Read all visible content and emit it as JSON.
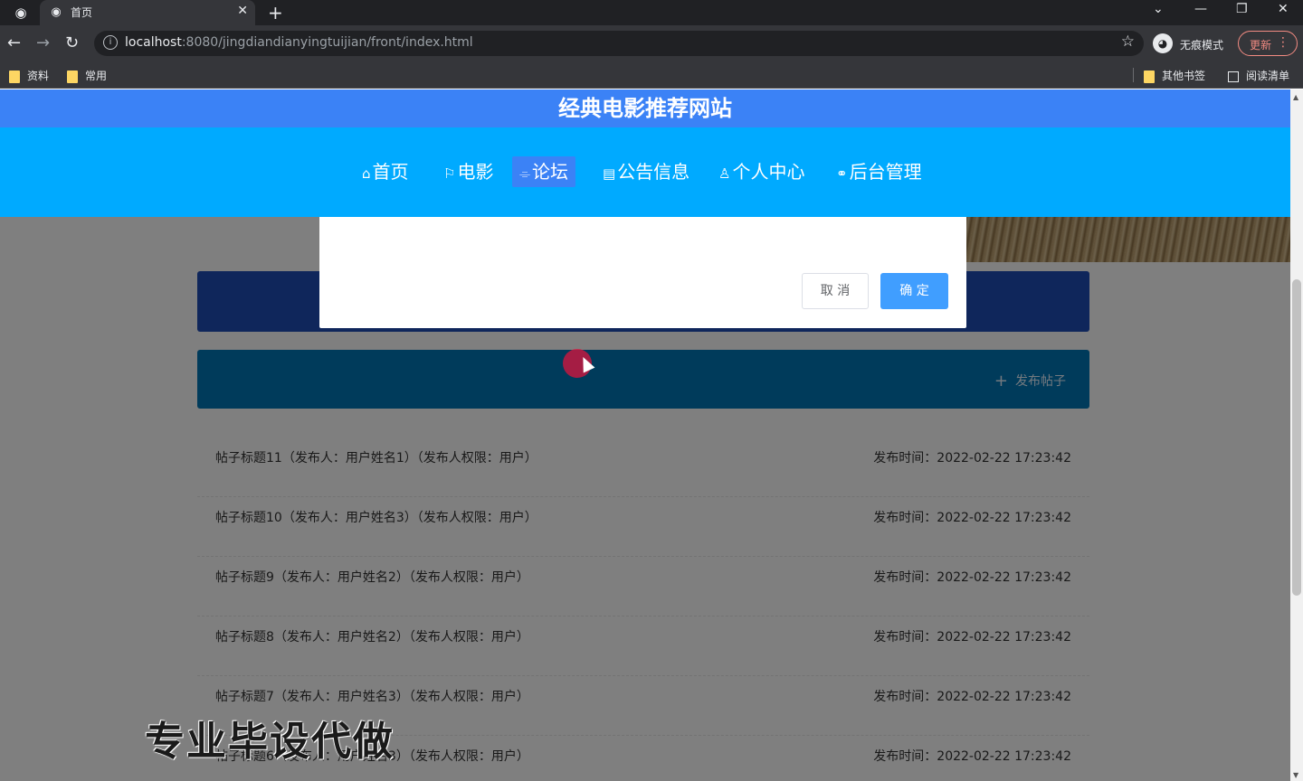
{
  "browser": {
    "tab_title": "首页",
    "new_tab": "+",
    "url_host": "localhost",
    "url_path": ":8080/jingdiandianyingtuijian/front/index.html",
    "incognito_label": "无痕模式",
    "update_label": "更新",
    "bookmarks": [
      "资料",
      "常用"
    ],
    "other_bookmarks": "其他书签",
    "reading_list": "阅读清单"
  },
  "site": {
    "title": "经典电影推荐网站",
    "nav": [
      {
        "icon": "⌂",
        "label": "首页"
      },
      {
        "icon": "⚐",
        "label": "电影"
      },
      {
        "icon": "⌯",
        "label": "论坛"
      },
      {
        "icon": "▤",
        "label": "公告信息"
      },
      {
        "icon": "♙",
        "label": "个人中心"
      },
      {
        "icon": "⚭",
        "label": "后台管理"
      }
    ],
    "active_nav": "论坛"
  },
  "dialog": {
    "cancel_label": "取 消",
    "ok_label": "确 定"
  },
  "forum": {
    "publish_icon": "+",
    "publish_label": "发布帖子",
    "posts": [
      {
        "title": "帖子标题11（发布人：用户姓名1）（发布人权限：用户）",
        "time": "发布时间：2022-02-22 17:23:42"
      },
      {
        "title": "帖子标题10（发布人：用户姓名3）（发布人权限：用户）",
        "time": "发布时间：2022-02-22 17:23:42"
      },
      {
        "title": "帖子标题9（发布人：用户姓名2）（发布人权限：用户）",
        "time": "发布时间：2022-02-22 17:23:42"
      },
      {
        "title": "帖子标题8（发布人：用户姓名2）（发布人权限：用户）",
        "time": "发布时间：2022-02-22 17:23:42"
      },
      {
        "title": "帖子标题7（发布人：用户姓名3）（发布人权限：用户）",
        "time": "发布时间：2022-02-22 17:23:42"
      },
      {
        "title": "帖子标题6（发布人：用户姓名3）（发布人权限：用户）",
        "time": "发布时间：2022-02-22 17:23:42"
      }
    ]
  },
  "watermark": "专业毕设代做",
  "colors": {
    "header": "#3b82f6",
    "navbar": "#00aaff",
    "primary_button": "#409eff"
  }
}
